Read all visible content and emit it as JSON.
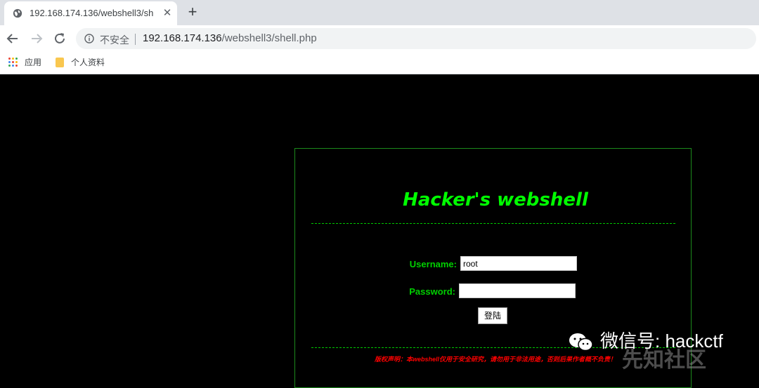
{
  "browser": {
    "tab_title": "192.168.174.136/webshell3/sh",
    "tab_close": "✕",
    "new_tab": "+",
    "insecure_label": "不安全",
    "url_host": "192.168.174.136",
    "url_path": "/webshell3/shell.php",
    "bookmarks": {
      "apps": "应用",
      "folder": "个人资料"
    }
  },
  "page": {
    "title": "Hacker's webshell",
    "username_label": "Username:",
    "username_value": "root",
    "password_label": "Password:",
    "password_value": "",
    "login_button": "登陆",
    "disclaimer": "版权声明：本webshell仅用于安全研究，请勿用于非法用途，否则后果作者概不负责！"
  },
  "watermarks": {
    "wechat": "微信号: hackctf",
    "site": "先知社区"
  },
  "colors": {
    "accent_green": "#00ff00",
    "disclaimer_red": "#ff0000",
    "background": "#000000"
  }
}
